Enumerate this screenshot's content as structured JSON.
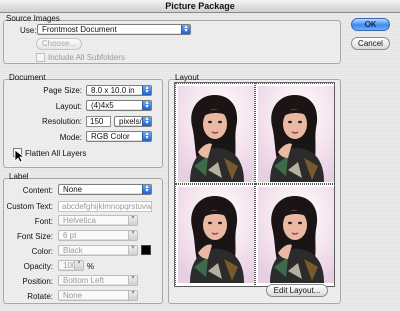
{
  "window": {
    "title": "Picture Package"
  },
  "buttons": {
    "ok": "OK",
    "cancel": "Cancel",
    "choose": "Choose...",
    "edit_layout": "Edit Layout..."
  },
  "source": {
    "group_label": "Source Images",
    "use_label": "Use:",
    "use_value": "Frontmost Document",
    "include_subfolders": "Include All Subfolders"
  },
  "document": {
    "group_label": "Document",
    "page_size_label": "Page Size:",
    "page_size_value": "8.0 x 10.0 in",
    "layout_label": "Layout:",
    "layout_value": "(4)4x5",
    "resolution_label": "Resolution:",
    "resolution_value": "150",
    "resolution_unit": "pixels/inch",
    "mode_label": "Mode:",
    "mode_value": "RGB Color",
    "flatten_label": "Flatten All Layers"
  },
  "label": {
    "group_label": "Label",
    "content_label": "Content:",
    "content_value": "None",
    "custom_text_label": "Custom Text:",
    "custom_text_value": "abcdefghijklmnopqrstuvwxyzabc",
    "font_label": "Font:",
    "font_value": "Helvetica",
    "font_size_label": "Font Size:",
    "font_size_value": "6 pt",
    "color_label": "Color:",
    "color_value": "Black",
    "opacity_label": "Opacity:",
    "opacity_value": "100",
    "opacity_unit": "%",
    "position_label": "Position:",
    "position_value": "Bottom Left",
    "rotate_label": "Rotate:",
    "rotate_value": "None"
  },
  "layout_panel": {
    "group_label": "Layout"
  },
  "colors": {
    "swatch": "#000000",
    "accent": "#2f73e0"
  }
}
